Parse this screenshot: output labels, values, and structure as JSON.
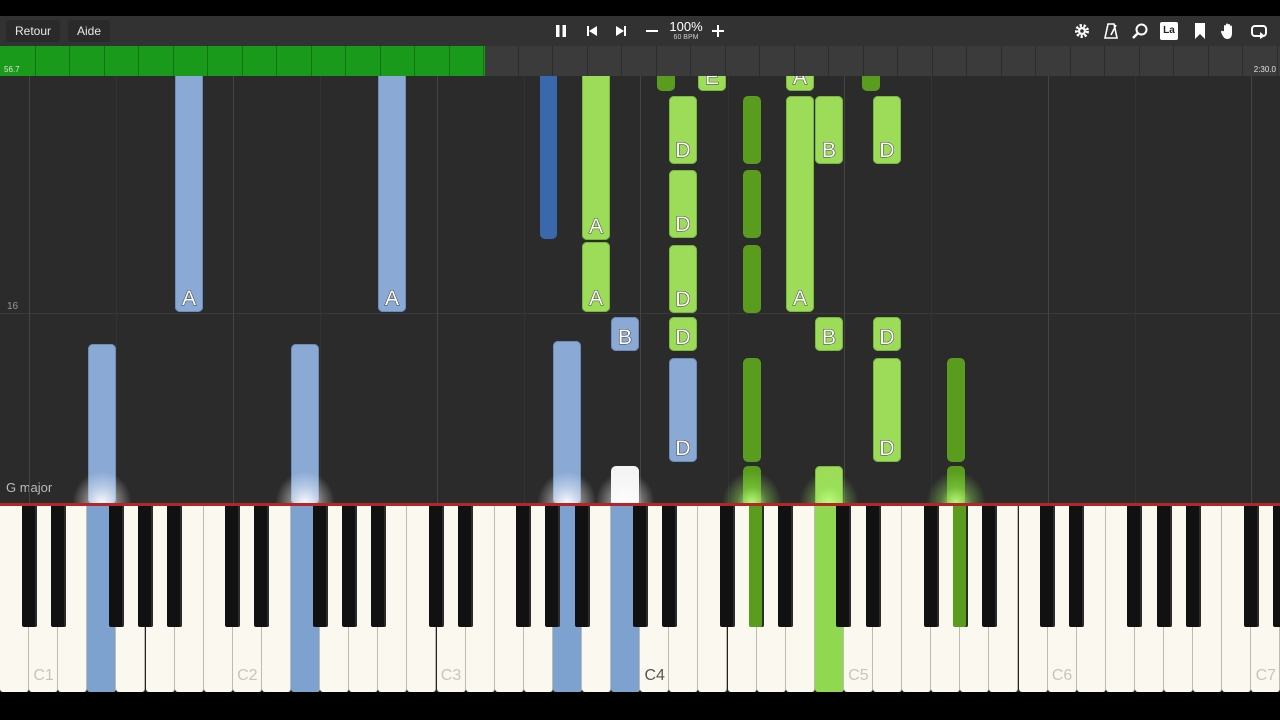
{
  "toolbar": {
    "back_label": "Retour",
    "help_label": "Aide",
    "speed_percent": "100%",
    "speed_bpm": "60 BPM",
    "icons": [
      "pause-icon",
      "skip-back-icon",
      "skip-forward-icon",
      "minus-icon",
      "plus-icon",
      "gear-icon",
      "metronome-icon",
      "search-icon",
      "note-label-icon",
      "bookmark-icon",
      "hand-icon",
      "loop-icon"
    ],
    "note_label_text": "La"
  },
  "progress": {
    "current_time": "56.7",
    "total_time": "2:30.0",
    "fraction": 0.379
  },
  "measure_number": "16",
  "key_signature": "G major",
  "note_letters": [
    "A",
    "A",
    "A",
    "A",
    "D",
    "D",
    "D",
    "D",
    "D",
    "B",
    "B",
    "B",
    "D",
    "D",
    "D",
    "A",
    "E",
    "A"
  ],
  "octave_labels": [
    "C1",
    "C2",
    "C3",
    "C4",
    "C5",
    "C6",
    "C7"
  ],
  "colors": {
    "left_hand": "#8aa9d4",
    "right_hand": "#9ddc58",
    "progress": "#1a9a1a",
    "hit_line": "#b3262a"
  }
}
